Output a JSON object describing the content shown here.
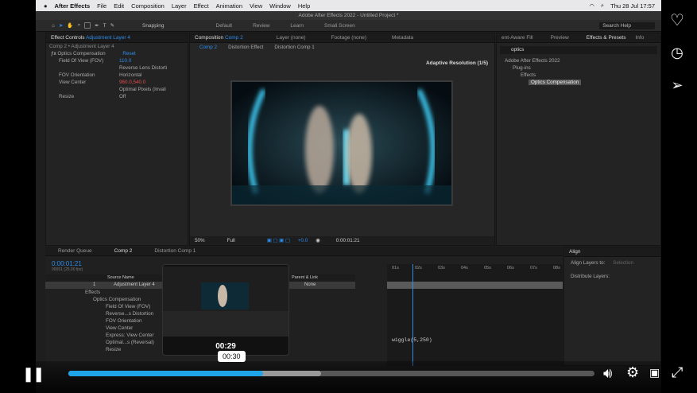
{
  "mac_menu": {
    "apple": "",
    "app": "After Effects",
    "items": [
      "File",
      "Edit",
      "Composition",
      "Layer",
      "Effect",
      "Animation",
      "View",
      "Window",
      "Help"
    ],
    "clock": "Thu 28 Jul  17:57"
  },
  "ae_title": "Adobe After Effects 2022 - Untitled Project *",
  "toolbar": {
    "snapping": "Snapping",
    "workspaces": [
      "Default",
      "Review",
      "Learn",
      "Small Screen"
    ],
    "search": "Search Help"
  },
  "effect_controls": {
    "tab": "Effect Controls",
    "tab_layer": "Adjustment Layer 4",
    "composition_tab": "Composition",
    "composition_tab_name": "Comp 2",
    "layer_tab": "Layer (none)",
    "footage_tab": "Footage (none)",
    "metadata_tab": "Metadata",
    "breadcrumb": "Comp 2 • Adjustment Layer 4",
    "effect_name": "Optics Compensation",
    "reset": "Reset",
    "props": [
      {
        "name": "Field Of View (FOV)",
        "value": "110.0"
      },
      {
        "name": "",
        "value": "Reverse Lens Distorti"
      },
      {
        "name": "FOV Orientation",
        "value": "Horizontal"
      },
      {
        "name": "View Center",
        "value": "960.0,540.0"
      },
      {
        "name": "",
        "value": "Optimal Pixels (Invali"
      },
      {
        "name": "Resize",
        "value": "Off"
      }
    ]
  },
  "composition": {
    "tabs": [
      "Comp 2",
      "Distortion Effect",
      "Distortion Comp 1"
    ],
    "adaptive": "Adaptive Resolution (1/5)",
    "zoom": "50%",
    "quality": "Full",
    "exposure": "+0.0",
    "time": "0:00:01:21"
  },
  "right_panel": {
    "tabs": [
      "ent-Aware Fill",
      "Preview",
      "Effects & Presets",
      "Info"
    ],
    "search": "optics",
    "tree": [
      "Adobe After Effects 2022",
      "Plug-ins",
      "Effects",
      "Optics Compensation"
    ]
  },
  "align": {
    "title": "Align",
    "align_layers_to": "Align Layers to:",
    "selection": "Selection",
    "distribute": "Distribute Layers:"
  },
  "timeline": {
    "tabs": [
      "Render Queue",
      "Comp 2",
      "Distortion Comp 1"
    ],
    "timecode": "0:00:01:21",
    "frames": "00051 (25.00 fps)",
    "col_source": "Source Name",
    "col_parent": "Parent & Link",
    "layer_num": "1",
    "layer_name": "Adjustment Layer 4",
    "parent_val": "None",
    "rows": [
      "Effects",
      "Optics Compensation",
      "Field Of View (FOV)",
      "Reverse...s Distortion",
      "FOV Orientation",
      "View Center",
      "Express: View Center",
      "Optimal...s (Reversal)",
      "Resize"
    ],
    "ruler": [
      "01s",
      "02s",
      "03s",
      "04s",
      "05s",
      "06s",
      "07s",
      "08s",
      "09s"
    ],
    "expression": "wiggle(5,250)"
  },
  "player": {
    "thumb_time": "00:29",
    "hover_time": "00:30",
    "progress": 0.37,
    "buffered": 0.48
  }
}
